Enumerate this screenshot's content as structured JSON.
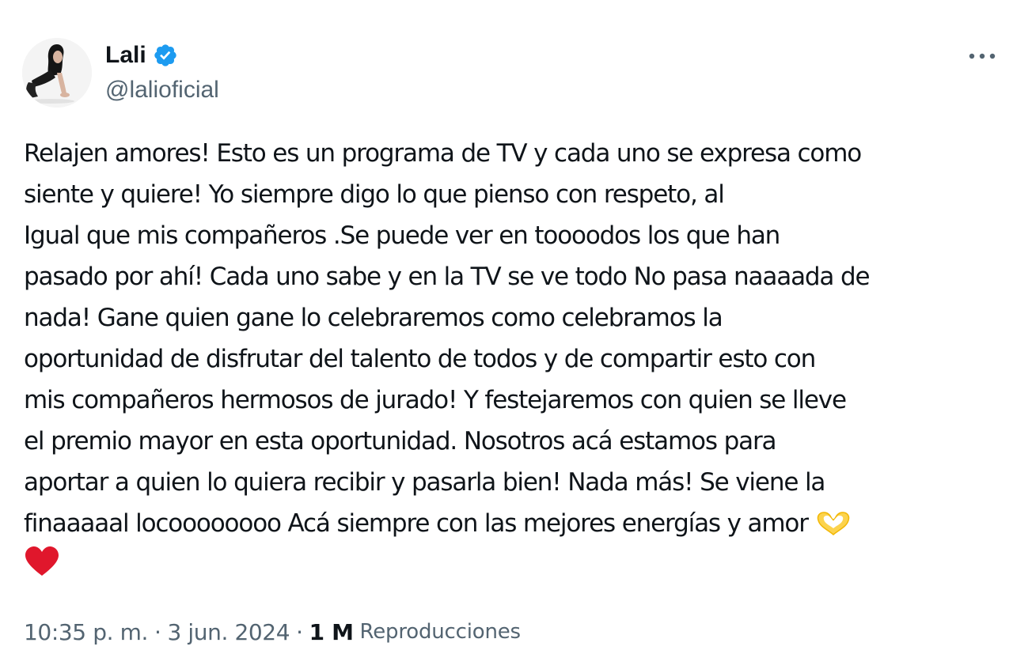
{
  "author": {
    "display_name": "Lali",
    "handle": "@lalioficial",
    "verified": true
  },
  "icons": {
    "verified": "verified-badge-icon",
    "more": "more-options-icon",
    "emoji_hands": "heart-hands-emoji",
    "emoji_heart": "red-heart-emoji"
  },
  "colors": {
    "text": "#0f1419",
    "secondary": "#536471",
    "verified_blue": "#1d9bf0",
    "heart_red": "#e0172c"
  },
  "tweet": {
    "lines": [
      "Relajen amores! Esto es un programa de TV y cada uno se expresa como",
      "siente y quiere! Yo siempre digo lo que pienso con respeto, al",
      "Igual que mis compañeros .Se puede ver en toooodos los que han",
      "pasado por ahí! Cada uno sabe y en la TV se ve todo No pasa naaaada de",
      "nada! Gane quien gane lo celebraremos como celebramos la",
      "oportunidad de disfrutar del talento de todos y de compartir esto con",
      "mis compañeros hermosos de jurado! Y festejaremos con quien se lleve",
      "el premio mayor en esta oportunidad. Nosotros acá estamos para",
      "aportar a quien lo quiera recibir y pasarla bien! Nada más! Se viene la",
      "finaaaaal locoooooooo Acá siempre con las mejores energías y amor"
    ]
  },
  "meta": {
    "time": "10:35 p. m.",
    "separator": "·",
    "date": "3 jun. 2024",
    "views_count": "1 M",
    "views_label": "Reproducciones"
  }
}
